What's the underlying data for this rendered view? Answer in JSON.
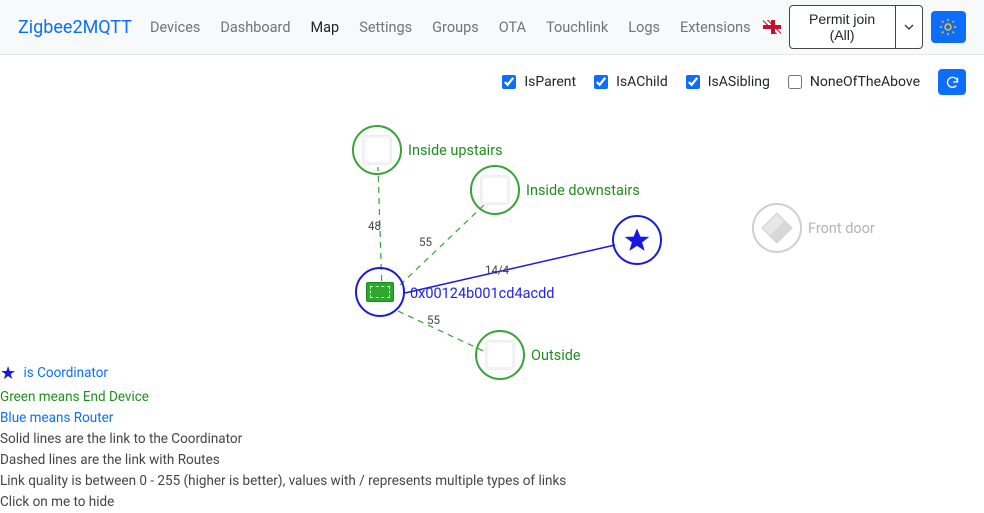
{
  "navbar": {
    "brand": "Zigbee2MQTT",
    "items": [
      "Devices",
      "Dashboard",
      "Map",
      "Settings",
      "Groups",
      "OTA",
      "Touchlink",
      "Logs",
      "Extensions"
    ],
    "active_index": 2,
    "permit_label": "Permit join (All)"
  },
  "filters": {
    "isparent": {
      "label": "IsParent",
      "checked": true
    },
    "isachild": {
      "label": "IsAChild",
      "checked": true
    },
    "isasibling": {
      "label": "IsASibling",
      "checked": true
    },
    "none": {
      "label": "NoneOfTheAbove",
      "checked": false
    }
  },
  "nodes": {
    "inside_upstairs": {
      "label": "Inside upstairs"
    },
    "inside_downstairs": {
      "label": "Inside downstairs"
    },
    "outside": {
      "label": "Outside"
    },
    "front_door": {
      "label": "Front door"
    },
    "router": {
      "label": "0x00124b001cd4acdd"
    }
  },
  "links": {
    "l_up": "48",
    "l_down": "55",
    "l_out": "55",
    "l_coord": "14/4"
  },
  "legend": {
    "l1": "is Coordinator",
    "l2": "Green means End Device",
    "l3": "Blue means Router",
    "l4": "Solid lines are the link to the Coordinator",
    "l5": "Dashed lines are the link with Routes",
    "l6": "Link quality is between 0 - 255 (higher is better), values with / represents multiple types of links",
    "l7": "Click on me to hide"
  }
}
